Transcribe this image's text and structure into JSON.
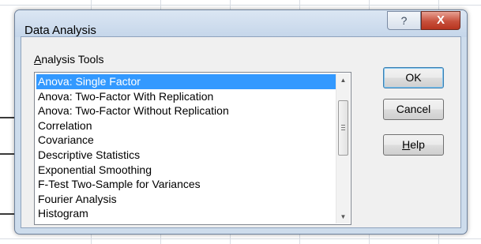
{
  "dialog": {
    "title": "Data Analysis",
    "help_button": "?",
    "close_button": "X"
  },
  "group": {
    "label_prefix": "",
    "label_underlined": "A",
    "label_rest": "nalysis Tools"
  },
  "tools": [
    "Anova: Single Factor",
    "Anova: Two-Factor With Replication",
    "Anova: Two-Factor Without Replication",
    "Correlation",
    "Covariance",
    "Descriptive Statistics",
    "Exponential Smoothing",
    "F-Test Two-Sample for Variances",
    "Fourier Analysis",
    "Histogram"
  ],
  "selected_index": 0,
  "buttons": {
    "ok": "OK",
    "cancel": "Cancel",
    "help_underlined": "H",
    "help_rest": "elp"
  },
  "colors": {
    "selection": "#3399ff",
    "close": "#c7503c"
  }
}
